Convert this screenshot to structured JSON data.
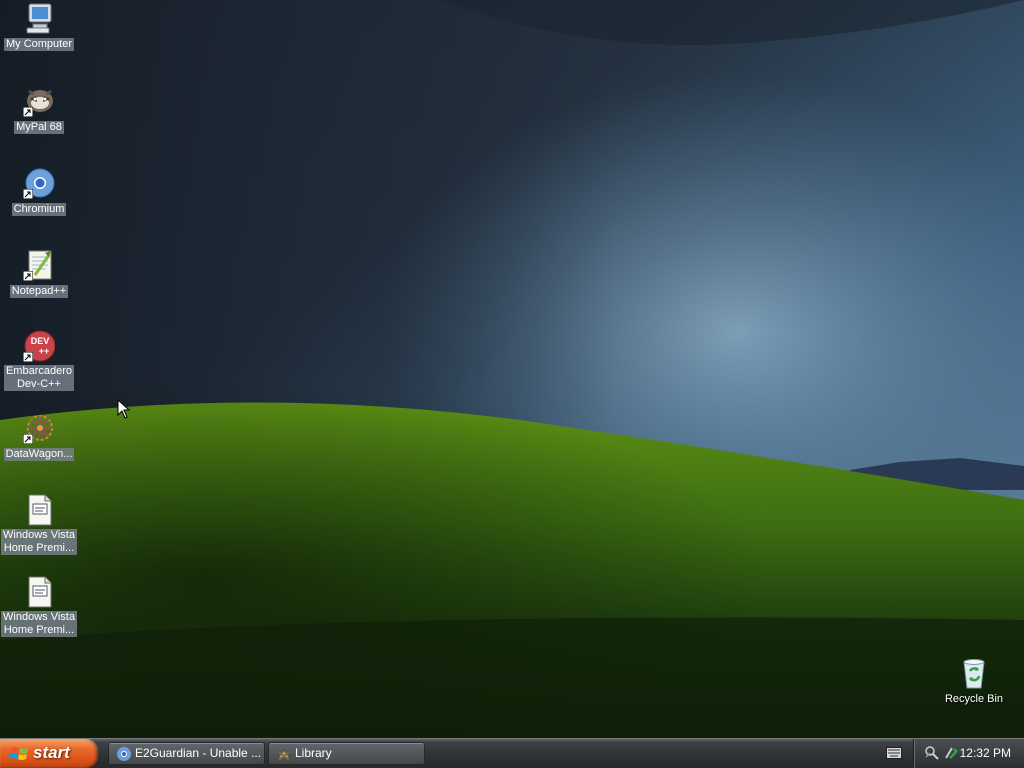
{
  "desktop": {
    "icons": [
      {
        "label": "My Computer",
        "icon": "my-computer-icon"
      },
      {
        "label": "MyPal 68",
        "icon": "mypal-icon"
      },
      {
        "label": "Chromium",
        "icon": "chromium-icon"
      },
      {
        "label": "Notepad++",
        "icon": "notepad-plus-plus-icon"
      },
      {
        "label": "Embarcadero\nDev-C++",
        "icon": "dev-cpp-icon"
      },
      {
        "label": "DataWagon...",
        "icon": "datawagon-icon"
      },
      {
        "label": "Windows Vista\nHome Premi...",
        "icon": "text-file-icon"
      },
      {
        "label": "Windows Vista\nHome Premi...",
        "icon": "text-file-icon"
      }
    ],
    "recycle_bin": {
      "label": "Recycle Bin",
      "icon": "recycle-bin-icon"
    },
    "dev_badge": {
      "line1": "DEV",
      "line2": "++"
    }
  },
  "taskbar": {
    "start_label": "start",
    "tasks": [
      {
        "label": "E2Guardian - Unable ...",
        "icon": "chromium-icon"
      },
      {
        "label": "Library",
        "icon": "library-icon"
      }
    ],
    "clock": "12:32 PM"
  },
  "colors": {
    "start_orange": "#d54f16",
    "taskbar_gray": "#2f3336",
    "label_bg": "#767e8a"
  }
}
